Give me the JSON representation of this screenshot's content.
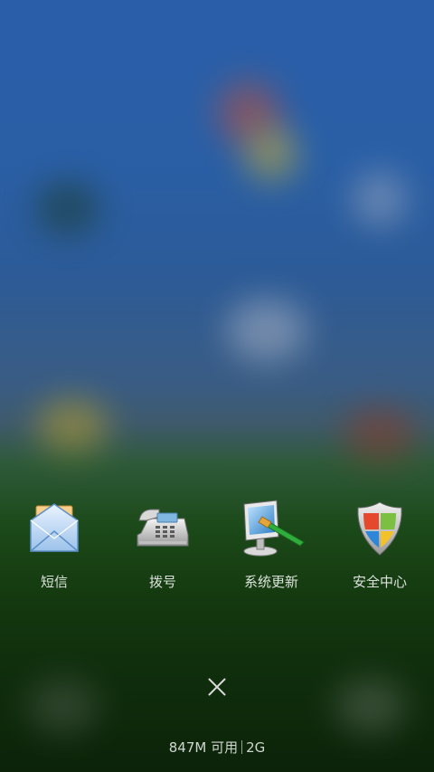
{
  "apps": [
    {
      "label": "短信",
      "icon": "envelope-icon"
    },
    {
      "label": "拨号",
      "icon": "phone-icon"
    },
    {
      "label": "系统更新",
      "icon": "system-update-icon"
    },
    {
      "label": "安全中心",
      "icon": "security-shield-icon"
    }
  ],
  "close": {
    "icon": "close-icon"
  },
  "status": {
    "memory": "847M 可用",
    "extra": "2G"
  },
  "colors": {
    "wallpaper_top": "#2a5ea9",
    "wallpaper_bottom": "#0c2309",
    "label": "#ffffff"
  }
}
